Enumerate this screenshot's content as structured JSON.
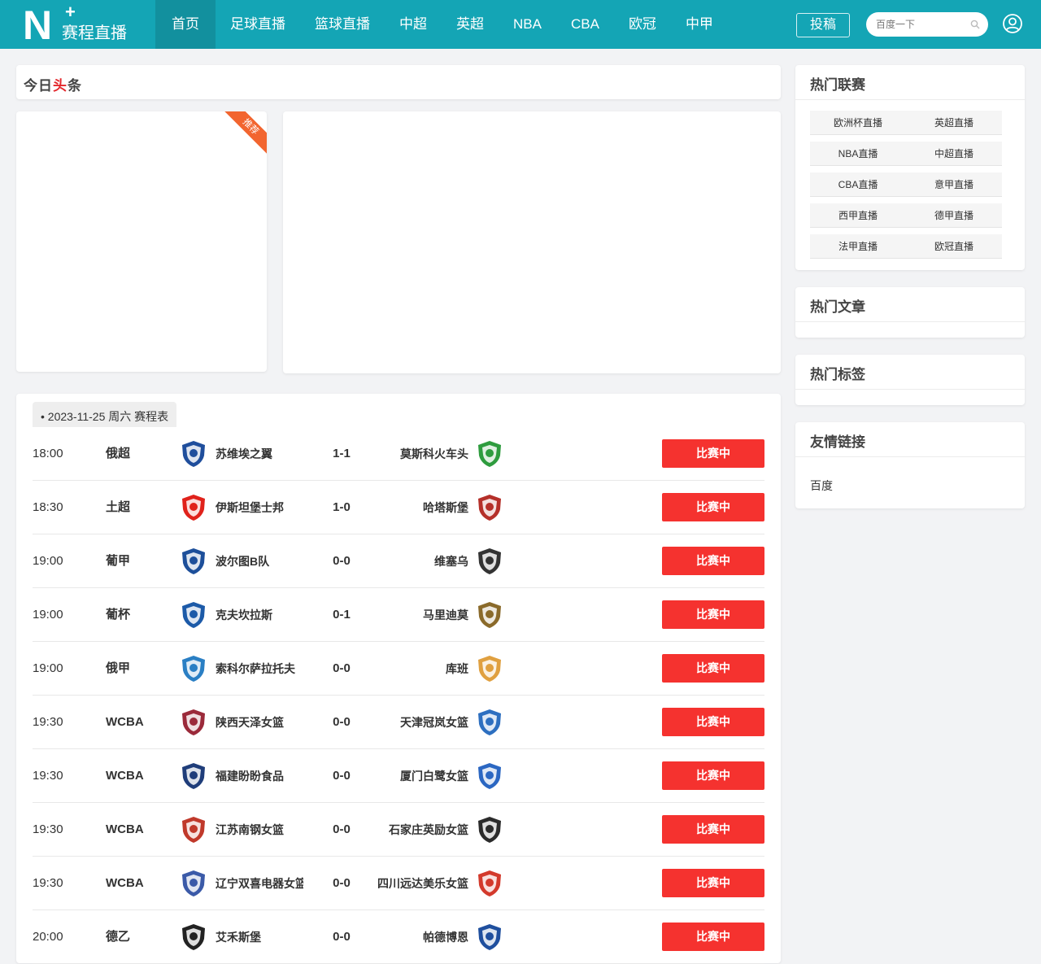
{
  "header": {
    "logo_letter": "N",
    "logo_plus": "+",
    "logo_text": "赛程直播",
    "nav": [
      {
        "label": "首页",
        "active": true
      },
      {
        "label": "足球直播"
      },
      {
        "label": "篮球直播"
      },
      {
        "label": "中超"
      },
      {
        "label": "英超"
      },
      {
        "label": "NBA"
      },
      {
        "label": "CBA"
      },
      {
        "label": "欧冠"
      },
      {
        "label": "中甲"
      }
    ],
    "contribute_label": "投稿",
    "search_placeholder": "百度一下"
  },
  "headline": {
    "title_part1": "今日",
    "title_part2": "头",
    "title_part3": "条",
    "badge": "推荐"
  },
  "schedule": {
    "date_label": "• 2023-11-25 周六 赛程表",
    "status_label": "比赛中",
    "matches": [
      {
        "time": "18:00",
        "league": "俄超",
        "home": "苏维埃之翼",
        "score": "1-1",
        "away": "莫斯科火车头",
        "home_color": "#1f4e9c",
        "away_color": "#2e9c3e"
      },
      {
        "time": "18:30",
        "league": "土超",
        "home": "伊斯坦堡士邦",
        "score": "1-0",
        "away": "哈塔斯堡",
        "home_color": "#e0221b",
        "away_color": "#b5302a"
      },
      {
        "time": "19:00",
        "league": "葡甲",
        "home": "波尔图B队",
        "score": "0-0",
        "away": "维塞乌",
        "home_color": "#1d4f9a",
        "away_color": "#333333"
      },
      {
        "time": "19:00",
        "league": "葡杯",
        "home": "克夫坎拉斯",
        "score": "0-1",
        "away": "马里迪莫",
        "home_color": "#1c5aa8",
        "away_color": "#8a6a2a"
      },
      {
        "time": "19:00",
        "league": "俄甲",
        "home": "索科尔萨拉托夫",
        "score": "0-0",
        "away": "库班",
        "home_color": "#2a7fc4",
        "away_color": "#e0a040"
      },
      {
        "time": "19:30",
        "league": "WCBA",
        "home": "陕西天泽女篮",
        "score": "0-0",
        "away": "天津冠岚女篮",
        "home_color": "#9b2a3a",
        "away_color": "#2d6fc0"
      },
      {
        "time": "19:30",
        "league": "WCBA",
        "home": "福建盼盼食品",
        "score": "0-0",
        "away": "厦门白鹭女篮",
        "home_color": "#1f3d7a",
        "away_color": "#2b67c2"
      },
      {
        "time": "19:30",
        "league": "WCBA",
        "home": "江苏南钢女篮",
        "score": "0-0",
        "away": "石家庄英励女篮",
        "home_color": "#c0392b",
        "away_color": "#2b2b2b"
      },
      {
        "time": "19:30",
        "league": "WCBA",
        "home": "辽宁双喜电器女篮",
        "score": "0-0",
        "away": "四川远达美乐女篮",
        "home_color": "#3b5aa8",
        "away_color": "#d33a2c"
      },
      {
        "time": "20:00",
        "league": "德乙",
        "home": "艾禾斯堡",
        "score": "0-0",
        "away": "帕德博恩",
        "home_color": "#222222",
        "away_color": "#1f4f9e"
      }
    ]
  },
  "sidebar": {
    "hot_leagues_title": "热门联赛",
    "hot_leagues": [
      "欧洲杯直播",
      "英超直播",
      "NBA直播",
      "中超直播",
      "CBA直播",
      "意甲直播",
      "西甲直播",
      "德甲直播",
      "法甲直播",
      "欧冠直播"
    ],
    "hot_articles_title": "热门文章",
    "hot_tags_title": "热门标签",
    "friend_links_title": "友情链接",
    "friend_links": [
      "百度"
    ]
  },
  "colors": {
    "header_bg": "#14a5b5",
    "nav_active": "#12909e",
    "status_button": "#f5322f",
    "ribbon": "#f2652f"
  }
}
